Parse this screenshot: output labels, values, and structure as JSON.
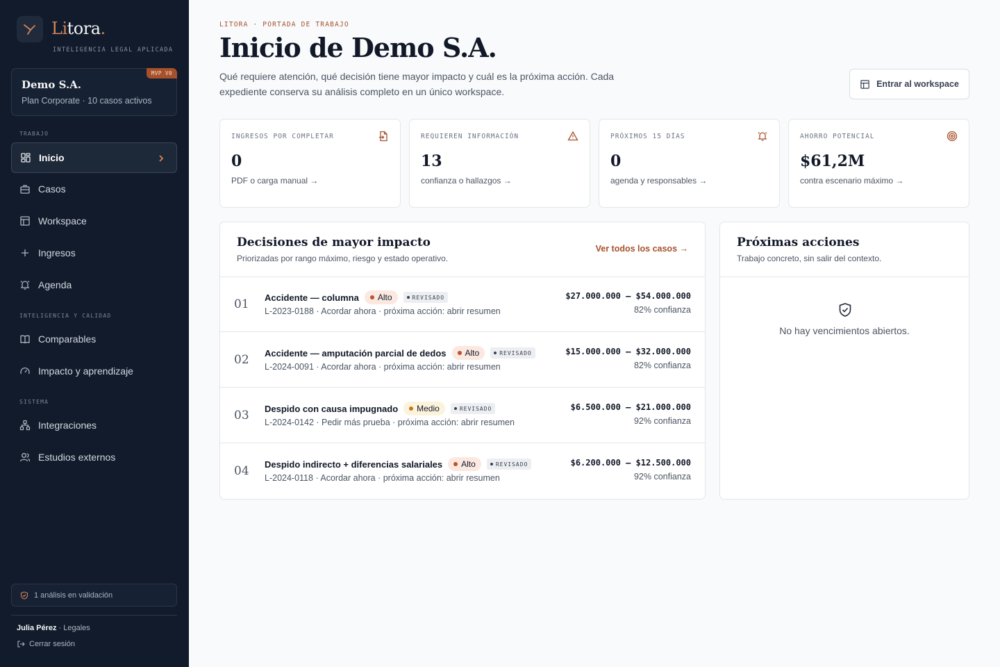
{
  "sidebar": {
    "logo_main": "Li",
    "logo_rest": "tora",
    "logo_dot": ".",
    "tagline": "INTELIGENCIA LEGAL APLICADA",
    "org": {
      "name": "Demo S.A.",
      "plan": "Plan Corporate · 10 casos activos",
      "badge": "MVP V0"
    },
    "sections": [
      {
        "label": "TRABAJO"
      },
      {
        "label": "INTELIGENCIA Y CALIDAD"
      },
      {
        "label": "SISTEMA"
      }
    ],
    "items": [
      {
        "label": "Inicio",
        "icon": "dashboard-icon",
        "active": true
      },
      {
        "label": "Casos",
        "icon": "briefcase-icon"
      },
      {
        "label": "Workspace",
        "icon": "layout-icon"
      },
      {
        "label": "Ingresos",
        "icon": "plus-icon"
      },
      {
        "label": "Agenda",
        "icon": "bell-icon"
      },
      {
        "label": "Comparables",
        "icon": "book-icon"
      },
      {
        "label": "Impacto y aprendizaje",
        "icon": "gauge-icon"
      },
      {
        "label": "Integraciones",
        "icon": "network-icon"
      },
      {
        "label": "Estudios externos",
        "icon": "users-icon"
      }
    ],
    "validation": "1 análisis en validación",
    "user_name": "Julia Pérez",
    "user_role": " · Legales",
    "logout": "Cerrar sesión"
  },
  "header": {
    "kicker": "LITORA · PORTADA DE TRABAJO",
    "title": "Inicio de Demo S.A.",
    "description": "Qué requiere atención, qué decisión tiene mayor impacto y cuál es la próxima acción. Cada expediente conserva su análisis completo en un único workspace.",
    "workspace_button": "Entrar al workspace"
  },
  "stats": [
    {
      "label": "INGRESOS POR COMPLETAR",
      "value": "0",
      "sub": "PDF o carga manual →",
      "icon": "file-import-icon"
    },
    {
      "label": "REQUIEREN INFORMACIÓN",
      "value": "13",
      "sub": "confianza o hallazgos →",
      "icon": "warning-icon"
    },
    {
      "label": "PRÓXIMOS 15 DÍAS",
      "value": "0",
      "sub": "agenda y responsables →",
      "icon": "bell-ring-icon"
    },
    {
      "label": "AHORRO POTENCIAL",
      "value": "$61,2M",
      "sub": "contra escenario máximo →",
      "icon": "target-icon"
    }
  ],
  "decisions": {
    "title": "Decisiones de mayor impacto",
    "subtitle": "Priorizadas por rango máximo, riesgo y estado operativo.",
    "link": "Ver todos los casos →",
    "rows": [
      {
        "num": "01",
        "title": "Accidente — columna",
        "risk": "Alto",
        "status": "REVISADO",
        "meta": "L-2023-0188 · Acordar ahora · próxima acción: abrir resumen",
        "range": "$27.000.000 – $54.000.000",
        "confidence": "82% confianza"
      },
      {
        "num": "02",
        "title": "Accidente — amputación parcial de dedos",
        "risk": "Alto",
        "status": "REVISADO",
        "meta": "L-2024-0091 · Acordar ahora · próxima acción: abrir resumen",
        "range": "$15.000.000 – $32.000.000",
        "confidence": "82% confianza"
      },
      {
        "num": "03",
        "title": "Despido con causa impugnado",
        "risk": "Medio",
        "status": "REVISADO",
        "meta": "L-2024-0142 · Pedir más prueba · próxima acción: abrir resumen",
        "range": "$6.500.000 – $21.000.000",
        "confidence": "92% confianza"
      },
      {
        "num": "04",
        "title": "Despido indirecto + diferencias salariales",
        "risk": "Alto",
        "status": "REVISADO",
        "meta": "L-2024-0118 · Acordar ahora · próxima acción: abrir resumen",
        "range": "$6.200.000 – $12.500.000",
        "confidence": "92% confianza"
      }
    ]
  },
  "actions": {
    "title": "Próximas acciones",
    "subtitle": "Trabajo concreto, sin salir del contexto.",
    "empty": "No hay vencimientos abiertos.",
    "empty_icon": "shield-check-icon"
  },
  "colors": {
    "accent": "#a6512b",
    "sidebar_bg": "#111b2b",
    "risk_high": "#c0502f",
    "risk_medium": "#c07a19"
  }
}
